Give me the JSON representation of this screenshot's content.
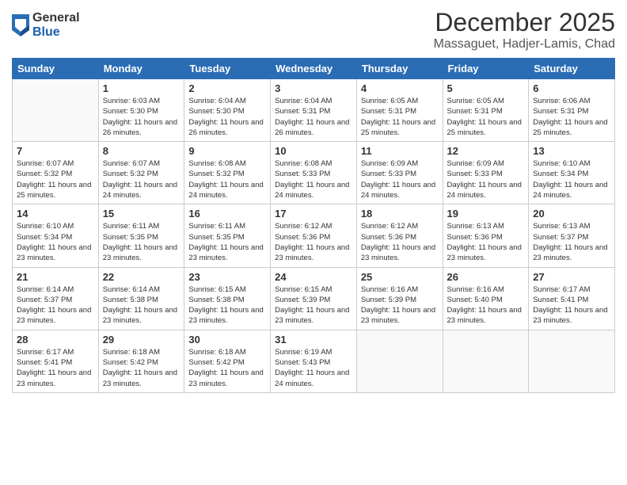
{
  "logo": {
    "general": "General",
    "blue": "Blue"
  },
  "title": "December 2025",
  "location": "Massaguet, Hadjer-Lamis, Chad",
  "days_of_week": [
    "Sunday",
    "Monday",
    "Tuesday",
    "Wednesday",
    "Thursday",
    "Friday",
    "Saturday"
  ],
  "weeks": [
    [
      {
        "day": "",
        "sunrise": "",
        "sunset": "",
        "daylight": ""
      },
      {
        "day": "1",
        "sunrise": "Sunrise: 6:03 AM",
        "sunset": "Sunset: 5:30 PM",
        "daylight": "Daylight: 11 hours and 26 minutes."
      },
      {
        "day": "2",
        "sunrise": "Sunrise: 6:04 AM",
        "sunset": "Sunset: 5:30 PM",
        "daylight": "Daylight: 11 hours and 26 minutes."
      },
      {
        "day": "3",
        "sunrise": "Sunrise: 6:04 AM",
        "sunset": "Sunset: 5:31 PM",
        "daylight": "Daylight: 11 hours and 26 minutes."
      },
      {
        "day": "4",
        "sunrise": "Sunrise: 6:05 AM",
        "sunset": "Sunset: 5:31 PM",
        "daylight": "Daylight: 11 hours and 25 minutes."
      },
      {
        "day": "5",
        "sunrise": "Sunrise: 6:05 AM",
        "sunset": "Sunset: 5:31 PM",
        "daylight": "Daylight: 11 hours and 25 minutes."
      },
      {
        "day": "6",
        "sunrise": "Sunrise: 6:06 AM",
        "sunset": "Sunset: 5:31 PM",
        "daylight": "Daylight: 11 hours and 25 minutes."
      }
    ],
    [
      {
        "day": "7",
        "sunrise": "Sunrise: 6:07 AM",
        "sunset": "Sunset: 5:32 PM",
        "daylight": "Daylight: 11 hours and 25 minutes."
      },
      {
        "day": "8",
        "sunrise": "Sunrise: 6:07 AM",
        "sunset": "Sunset: 5:32 PM",
        "daylight": "Daylight: 11 hours and 24 minutes."
      },
      {
        "day": "9",
        "sunrise": "Sunrise: 6:08 AM",
        "sunset": "Sunset: 5:32 PM",
        "daylight": "Daylight: 11 hours and 24 minutes."
      },
      {
        "day": "10",
        "sunrise": "Sunrise: 6:08 AM",
        "sunset": "Sunset: 5:33 PM",
        "daylight": "Daylight: 11 hours and 24 minutes."
      },
      {
        "day": "11",
        "sunrise": "Sunrise: 6:09 AM",
        "sunset": "Sunset: 5:33 PM",
        "daylight": "Daylight: 11 hours and 24 minutes."
      },
      {
        "day": "12",
        "sunrise": "Sunrise: 6:09 AM",
        "sunset": "Sunset: 5:33 PM",
        "daylight": "Daylight: 11 hours and 24 minutes."
      },
      {
        "day": "13",
        "sunrise": "Sunrise: 6:10 AM",
        "sunset": "Sunset: 5:34 PM",
        "daylight": "Daylight: 11 hours and 24 minutes."
      }
    ],
    [
      {
        "day": "14",
        "sunrise": "Sunrise: 6:10 AM",
        "sunset": "Sunset: 5:34 PM",
        "daylight": "Daylight: 11 hours and 23 minutes."
      },
      {
        "day": "15",
        "sunrise": "Sunrise: 6:11 AM",
        "sunset": "Sunset: 5:35 PM",
        "daylight": "Daylight: 11 hours and 23 minutes."
      },
      {
        "day": "16",
        "sunrise": "Sunrise: 6:11 AM",
        "sunset": "Sunset: 5:35 PM",
        "daylight": "Daylight: 11 hours and 23 minutes."
      },
      {
        "day": "17",
        "sunrise": "Sunrise: 6:12 AM",
        "sunset": "Sunset: 5:36 PM",
        "daylight": "Daylight: 11 hours and 23 minutes."
      },
      {
        "day": "18",
        "sunrise": "Sunrise: 6:12 AM",
        "sunset": "Sunset: 5:36 PM",
        "daylight": "Daylight: 11 hours and 23 minutes."
      },
      {
        "day": "19",
        "sunrise": "Sunrise: 6:13 AM",
        "sunset": "Sunset: 5:36 PM",
        "daylight": "Daylight: 11 hours and 23 minutes."
      },
      {
        "day": "20",
        "sunrise": "Sunrise: 6:13 AM",
        "sunset": "Sunset: 5:37 PM",
        "daylight": "Daylight: 11 hours and 23 minutes."
      }
    ],
    [
      {
        "day": "21",
        "sunrise": "Sunrise: 6:14 AM",
        "sunset": "Sunset: 5:37 PM",
        "daylight": "Daylight: 11 hours and 23 minutes."
      },
      {
        "day": "22",
        "sunrise": "Sunrise: 6:14 AM",
        "sunset": "Sunset: 5:38 PM",
        "daylight": "Daylight: 11 hours and 23 minutes."
      },
      {
        "day": "23",
        "sunrise": "Sunrise: 6:15 AM",
        "sunset": "Sunset: 5:38 PM",
        "daylight": "Daylight: 11 hours and 23 minutes."
      },
      {
        "day": "24",
        "sunrise": "Sunrise: 6:15 AM",
        "sunset": "Sunset: 5:39 PM",
        "daylight": "Daylight: 11 hours and 23 minutes."
      },
      {
        "day": "25",
        "sunrise": "Sunrise: 6:16 AM",
        "sunset": "Sunset: 5:39 PM",
        "daylight": "Daylight: 11 hours and 23 minutes."
      },
      {
        "day": "26",
        "sunrise": "Sunrise: 6:16 AM",
        "sunset": "Sunset: 5:40 PM",
        "daylight": "Daylight: 11 hours and 23 minutes."
      },
      {
        "day": "27",
        "sunrise": "Sunrise: 6:17 AM",
        "sunset": "Sunset: 5:41 PM",
        "daylight": "Daylight: 11 hours and 23 minutes."
      }
    ],
    [
      {
        "day": "28",
        "sunrise": "Sunrise: 6:17 AM",
        "sunset": "Sunset: 5:41 PM",
        "daylight": "Daylight: 11 hours and 23 minutes."
      },
      {
        "day": "29",
        "sunrise": "Sunrise: 6:18 AM",
        "sunset": "Sunset: 5:42 PM",
        "daylight": "Daylight: 11 hours and 23 minutes."
      },
      {
        "day": "30",
        "sunrise": "Sunrise: 6:18 AM",
        "sunset": "Sunset: 5:42 PM",
        "daylight": "Daylight: 11 hours and 23 minutes."
      },
      {
        "day": "31",
        "sunrise": "Sunrise: 6:19 AM",
        "sunset": "Sunset: 5:43 PM",
        "daylight": "Daylight: 11 hours and 24 minutes."
      },
      {
        "day": "",
        "sunrise": "",
        "sunset": "",
        "daylight": ""
      },
      {
        "day": "",
        "sunrise": "",
        "sunset": "",
        "daylight": ""
      },
      {
        "day": "",
        "sunrise": "",
        "sunset": "",
        "daylight": ""
      }
    ]
  ]
}
